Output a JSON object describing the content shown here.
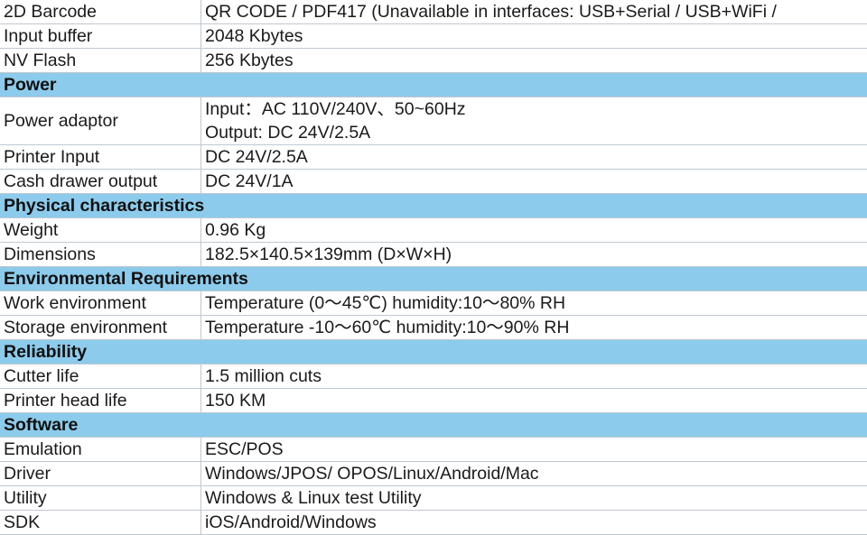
{
  "rows": [
    {
      "type": "item",
      "label": "2D Barcode",
      "values": [
        "QR CODE / PDF417 (Unavailable in interfaces: USB+Serial  / USB+WiFi /"
      ]
    },
    {
      "type": "item",
      "label": "Input buffer",
      "values": [
        " 2048 Kbytes"
      ]
    },
    {
      "type": "item",
      "label": "NV Flash",
      "values": [
        "256 Kbytes"
      ]
    },
    {
      "type": "section",
      "label": "Power"
    },
    {
      "type": "item",
      "label": "Power adaptor",
      "values": [
        "Input：AC 110V/240V、50~60Hz",
        "Output: DC 24V/2.5A"
      ]
    },
    {
      "type": "item",
      "label": "Printer Input",
      "values": [
        "DC 24V/2.5A"
      ]
    },
    {
      "type": "item",
      "label": "Cash drawer output",
      "values": [
        "DC 24V/1A"
      ]
    },
    {
      "type": "section",
      "label": "Physical characteristics"
    },
    {
      "type": "item",
      "label": "Weight",
      "values": [
        "0.96 Kg"
      ]
    },
    {
      "type": "item",
      "label": "Dimensions",
      "values": [
        "182.5×140.5×139mm (D×W×H)"
      ]
    },
    {
      "type": "section",
      "label": "Environmental Requirements"
    },
    {
      "type": "item",
      "label": "Work environment",
      "values": [
        "Temperature (0～45℃)  humidity:10～80% RH"
      ]
    },
    {
      "type": "item",
      "label": "Storage environment",
      "values": [
        "Temperature -10～60℃  humidity:10～90% RH"
      ]
    },
    {
      "type": "section",
      "label": "Reliability"
    },
    {
      "type": "item",
      "label": "Cutter life",
      "values": [
        "1.5 million cuts"
      ]
    },
    {
      "type": "item",
      "label": "Printer head life",
      "values": [
        "150 KM"
      ]
    },
    {
      "type": "section",
      "label": "Software"
    },
    {
      "type": "item",
      "label": "Emulation",
      "values": [
        "ESC/POS"
      ]
    },
    {
      "type": "item",
      "label": "Driver",
      "values": [
        "Windows/JPOS/ OPOS/Linux/Android/Mac"
      ]
    },
    {
      "type": "item",
      "label": "Utility",
      "values": [
        "Windows & Linux test Utility"
      ]
    },
    {
      "type": "item",
      "label": "SDK",
      "values": [
        "iOS/Android/Windows"
      ]
    }
  ],
  "colors": {
    "section_bg": "#8ccbeb",
    "border": "#bfc8d0",
    "text": "#1a1a1a"
  }
}
